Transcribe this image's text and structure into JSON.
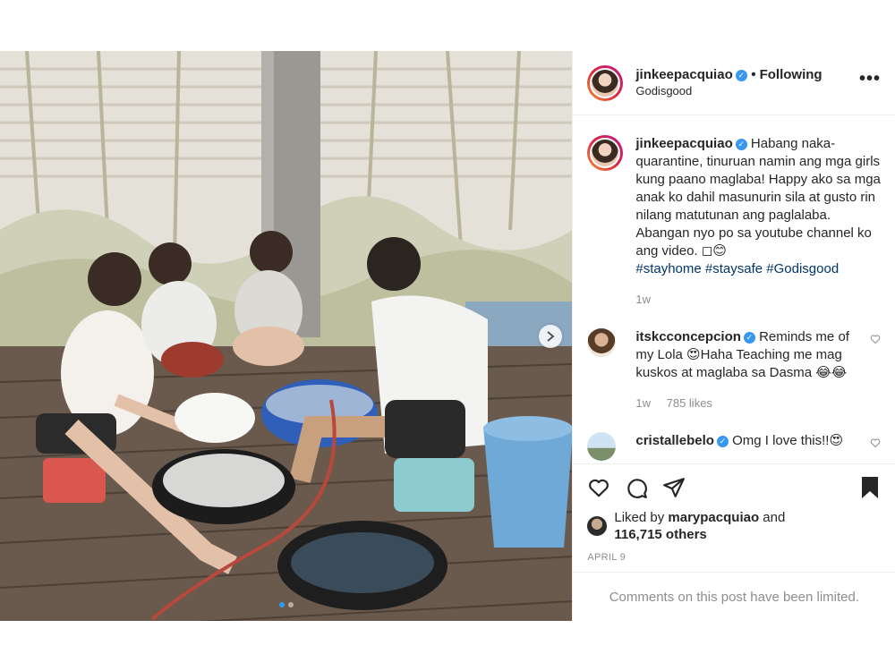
{
  "post": {
    "author": {
      "username": "jinkeepacquiao",
      "verified_icon": "verified-badge-icon",
      "follow_status": "Following",
      "location": "Godisgood"
    },
    "more_label": "•••",
    "photo": {
      "carousel_dots": 2,
      "active_dot": 1,
      "next_icon": "chevron-right-icon"
    },
    "caption": {
      "username": "jinkeepacquiao",
      "text": "Habang naka-quarantine, tinuruan namin ang mga girls kung paano maglaba! Happy ako sa mga anak ko dahil masunurin sila at gusto rin nilang matutunan ang paglalaba. Abangan nyo po sa youtube channel ko ang video. ◻😊",
      "hashtags": "#stayhome #staysafe #Godisgood",
      "time": "1w"
    },
    "comments": [
      {
        "username": "itskcconcepcion",
        "text": "Reminds me of my Lola 😍Haha Teaching me mag kuskos at maglaba sa Dasma 😂😂",
        "time": "1w",
        "likes": "785 likes"
      },
      {
        "username": "cristallebelo",
        "text": "Omg I love this!!😍",
        "time": "",
        "likes": ""
      }
    ],
    "liked_by": {
      "prefix": "Liked by ",
      "user": "marypacquiao",
      "suffix": " and",
      "others": "116,715 others"
    },
    "date": "APRIL 9",
    "comments_limited": "Comments on this post have been limited."
  },
  "colors": {
    "verified": "#3897f0",
    "hashtag": "#00376b",
    "muted": "#8e8e8e",
    "border": "#efefef"
  }
}
